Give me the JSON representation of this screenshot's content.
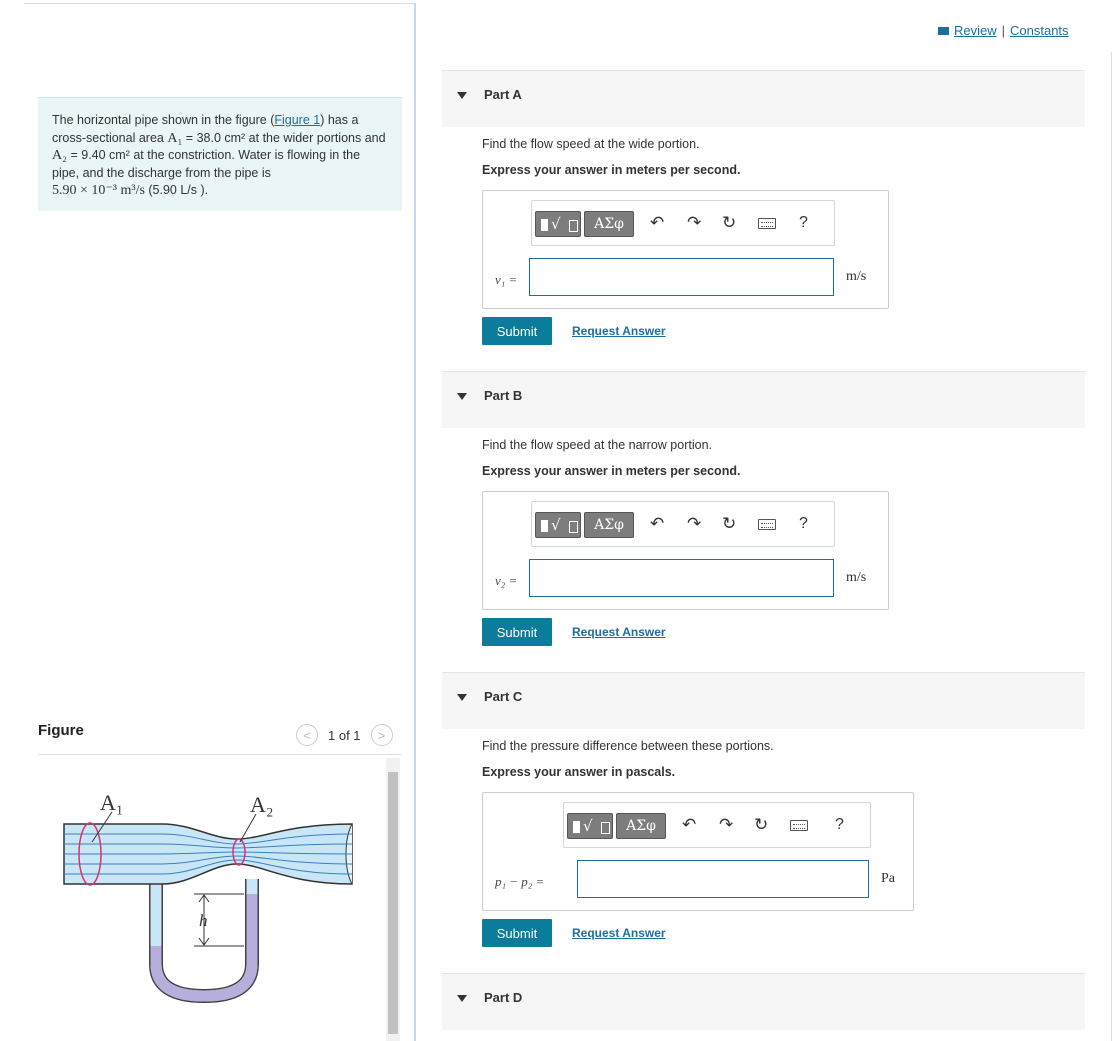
{
  "header": {
    "review_label": "Review",
    "separator": "|",
    "constants_label": "Constants"
  },
  "problem": {
    "text_1": "The horizontal pipe shown in the figure (",
    "figure_link": "Figure 1",
    "text_2": ") has a cross-sectional area ",
    "a1_sym": "A₁",
    "a1_val": " = 38.0 cm²",
    "text_3": " at the wider portions and ",
    "a2_sym": "A₂",
    "a2_val": " = 9.40 cm²",
    "text_4": " at the constriction. Water is flowing in the pipe, and the discharge from the pipe is",
    "discharge": "5.90 × 10⁻³ m³/s",
    "discharge_alt": " (5.90 L/s )."
  },
  "figure": {
    "title": "Figure",
    "pager": "1 of 1",
    "prev_icon": "chevron-left",
    "next_icon": "chevron-right",
    "label_a1": "A₁",
    "label_a2": "A₂",
    "label_h": "h"
  },
  "toolbar": {
    "greek_label": "ΑΣφ",
    "undo_icon": "↶",
    "redo_icon": "↷",
    "reset_icon": "↻",
    "help_label": "?"
  },
  "parts": [
    {
      "title": "Part A",
      "prompt": "Find the flow speed at the wide portion.",
      "instruction": "Express your answer in meters per second.",
      "variable": "v₁ =",
      "unit": "m/s",
      "value": "",
      "submit_label": "Submit",
      "request_label": "Request Answer"
    },
    {
      "title": "Part B",
      "prompt": "Find the flow speed at the narrow portion.",
      "instruction": "Express your answer in meters per second.",
      "variable": "v₂ =",
      "unit": "m/s",
      "value": "",
      "submit_label": "Submit",
      "request_label": "Request Answer"
    },
    {
      "title": "Part C",
      "prompt": "Find the pressure difference between these portions.",
      "instruction": "Express your answer in pascals.",
      "variable": "p₁ − p₂ =",
      "unit": "Pa",
      "value": "",
      "submit_label": "Submit",
      "request_label": "Request Answer"
    },
    {
      "title": "Part D"
    }
  ],
  "colors": {
    "accent": "#0b7c9a",
    "link": "#1a6fa0",
    "panel": "#e9f5f6",
    "header_bg": "#f6f6f6"
  }
}
